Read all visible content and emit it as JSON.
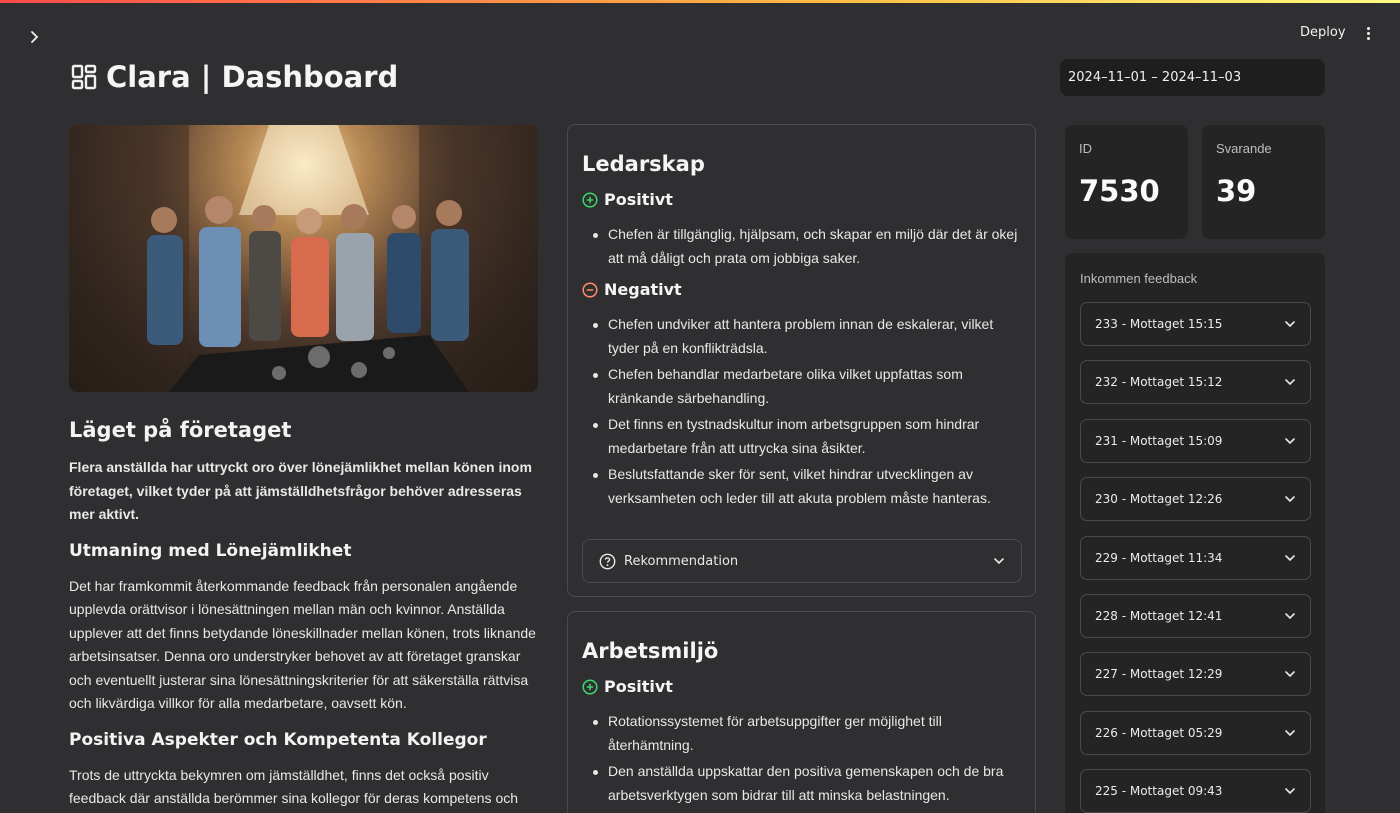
{
  "header": {
    "deploy_label": "Deploy",
    "title": "Clara | Dashboard",
    "date_range": "2024–11–01 – 2024–11–03"
  },
  "left": {
    "heading": "Läget på företaget",
    "intro": "Flera anställda har uttryckt oro över lönejämlikhet mellan könen inom företaget, vilket tyder på att jämställdhetsfrågor behöver adresseras mer aktivt.",
    "section1_title": "Utmaning med Lönejämlikhet",
    "section1_text": "Det har framkommit återkommande feedback från personalen angående upplevda orättvisor i lönesättningen mellan män och kvinnor. Anställda upplever att det finns betydande löneskillnader mellan könen, trots liknande arbetsinsatser. Denna oro understryker behovet av att företaget granskar och eventuellt justerar sina lönesättningskriterier för att säkerställa rättvisa och likvärdiga villkor för alla medarbetare, oavsett kön.",
    "section2_title": "Positiva Aspekter och Kompetenta Kollegor",
    "section2_text": "Trots de uttryckta bekymren om jämställdhet, finns det också positiv feedback där anställda berömmer sina kollegor för deras kompetens och"
  },
  "cards": [
    {
      "title": "Ledarskap",
      "positive_label": "Positivt",
      "positive": [
        "Chefen är tillgänglig, hjälpsam, och skapar en miljö där det är okej att må dåligt och prata om jobbiga saker."
      ],
      "negative_label": "Negativt",
      "negative": [
        "Chefen undviker att hantera problem innan de eskalerar, vilket tyder på en konflikträdsla.",
        "Chefen behandlar medarbetare olika vilket uppfattas som kränkande särbehandling.",
        "Det finns en tystnadskultur inom arbetsgruppen som hindrar medarbetare från att uttrycka sina åsikter.",
        "Beslutsfattande sker för sent, vilket hindrar utvecklingen av verksamheten och leder till att akuta problem måste hanteras."
      ],
      "recommendation_label": "Rekommendation"
    },
    {
      "title": "Arbetsmiljö",
      "positive_label": "Positivt",
      "positive": [
        "Rotationssystemet för arbetsuppgifter ger möjlighet till återhämtning.",
        "Den anställda uppskattar den positiva gemenskapen och de bra arbetsverktygen som bidrar till att minska belastningen."
      ]
    }
  ],
  "metrics": {
    "id_label": "ID",
    "id_value": "7530",
    "respondents_label": "Svarande",
    "respondents_value": "39"
  },
  "feedback": {
    "label": "Inkommen feedback",
    "items": [
      "233 - Mottaget 15:15",
      "232 - Mottaget 15:12",
      "231 - Mottaget 15:09",
      "230 - Mottaget 12:26",
      "229 - Mottaget 11:34",
      "228 - Mottaget 12:41",
      "227 - Mottaget 12:29",
      "226 - Mottaget 05:29",
      "225 - Mottaget 09:43"
    ]
  },
  "colors": {
    "positive": "#3dd56d",
    "negative": "#ff8c69",
    "background": "#2f2f31",
    "panel": "#242425"
  }
}
